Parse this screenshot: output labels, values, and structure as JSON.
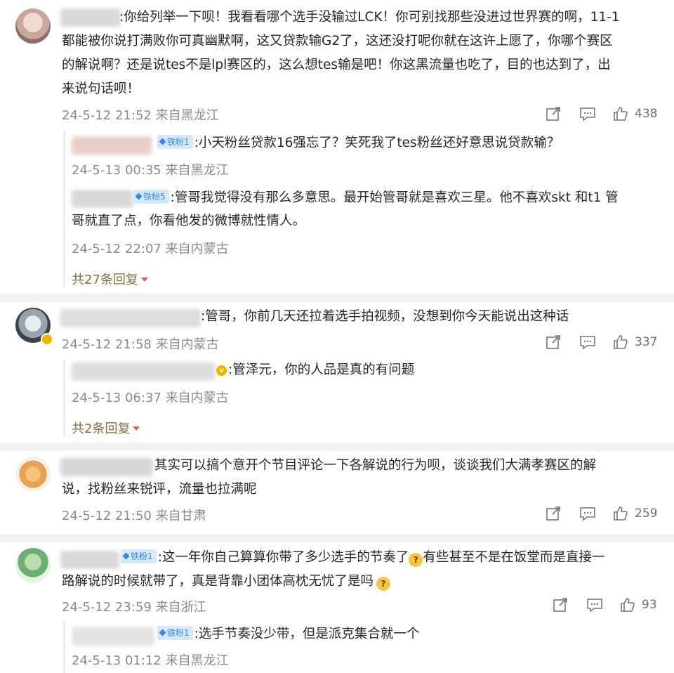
{
  "comments": [
    {
      "text_lines": [
        ":你给列举一下呗！我看看哪个选手没输过LCK！你可别找那些没进过世界赛的啊，11-1",
        "都能被你说打满败你可真幽默啊，这又贷款输G2了，这还没打呢你就在这许上愿了，你哪个赛区",
        "的解说啊？还是说tes不是lpl赛区的，这么想tes输是吧！你这黑流量也吃了，目的也达到了，出",
        "来说句话呗！"
      ],
      "meta": "24-5-12 21:52 来自黑龙江",
      "likes": "438",
      "replies": [
        {
          "badge": "铁粉1",
          "text_lines": [
            ":小天粉丝贷款16强忘了？笑死我了tes粉丝还好意思说贷款输？"
          ],
          "meta": "24-5-13 00:35 来自黑龙江"
        },
        {
          "badge": "铁粉5",
          "text_lines": [
            ":管哥我觉得没有那么多意思。最开始管哥就是喜欢三星。他不喜欢skt 和t1 管",
            "哥就直了点，你看他发的微博就性情人。"
          ],
          "meta": "24-5-12 22:07 来自内蒙古"
        }
      ],
      "more": "共27条回复"
    },
    {
      "text_lines": [
        ":管哥，你前几天还拉着选手拍视频，没想到你今天能说出这种话"
      ],
      "meta": "24-5-12 21:58 来自内蒙古",
      "likes": "337",
      "replies": [
        {
          "badge": "",
          "text_lines": [
            ":管泽元，你的人品是真的有问题"
          ],
          "meta": "24-5-13 06:37 来自内蒙古"
        }
      ],
      "more": "共2条回复"
    },
    {
      "text_lines": [
        "其实可以搞个意开个节目评论一下各解说的行为呗，谈谈我们大满孝赛区的解",
        "说，找粉丝来锐评，流量也拉满呢"
      ],
      "meta": "24-5-12 21:50 来自甘肃",
      "likes": "259"
    },
    {
      "badge": "铁粉1",
      "text_lines": [
        ":这一年你自己算算你带了多少选手的节奏了",
        "有些甚至不是在饭堂而是直接一",
        "路解说的时候就带了，真是背靠小团体高枕无忧了是吗"
      ],
      "meta": "24-5-12 23:59 来自浙江",
      "likes": "93",
      "replies": [
        {
          "badge": "铁粉1",
          "text_lines": [
            ":选手节奏没少带，但是派克集合就一个"
          ],
          "meta": "24-5-13 01:12 来自黑龙江"
        }
      ]
    }
  ],
  "icons": {
    "share": "share-icon",
    "comment": "comment-icon",
    "like": "thumbs-up-icon"
  },
  "colors": {
    "badge_bg": "#d6e8fb",
    "badge_text": "#3b87de",
    "meta": "#8b8b8b",
    "more": "#8a6f3f"
  }
}
